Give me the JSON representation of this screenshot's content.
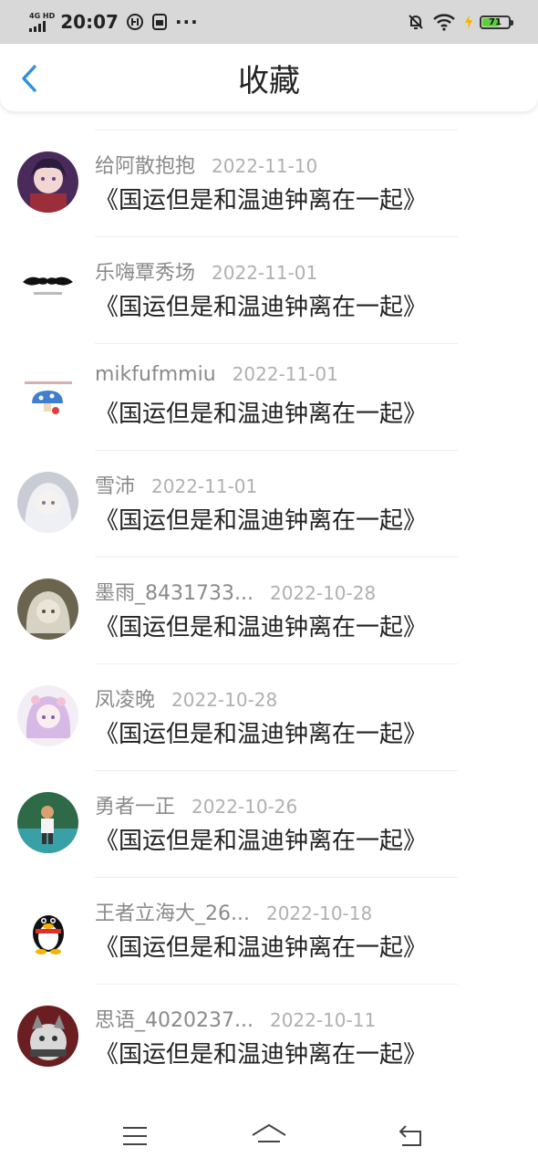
{
  "status_bar": {
    "network": "4G HD",
    "time": "20:07",
    "battery": 71,
    "battery_label": "71",
    "accent_color": "#5ad13c"
  },
  "header": {
    "title": "收藏",
    "back_icon": "chevron-left-icon",
    "accent_color": "#2f8fe0"
  },
  "favorites": [
    {
      "user": "给阿散抱抱",
      "date": "2022-11-10",
      "title": "《国运但是和温迪钟离在一起》"
    },
    {
      "user": "乐嗨覃秀场",
      "date": "2022-11-01",
      "title": "《国运但是和温迪钟离在一起》"
    },
    {
      "user": "mikfufmmiu",
      "date": "2022-11-01",
      "title": "《国运但是和温迪钟离在一起》"
    },
    {
      "user": "雪沛",
      "date": "2022-11-01",
      "title": "《国运但是和温迪钟离在一起》"
    },
    {
      "user": "墨雨_8431733...",
      "date": "2022-10-28",
      "title": "《国运但是和温迪钟离在一起》"
    },
    {
      "user": "凤凌晚",
      "date": "2022-10-28",
      "title": "《国运但是和温迪钟离在一起》"
    },
    {
      "user": "勇者一正",
      "date": "2022-10-26",
      "title": "《国运但是和温迪钟离在一起》"
    },
    {
      "user": "王者立海大_26...",
      "date": "2022-10-18",
      "title": "《国运但是和温迪钟离在一起》"
    },
    {
      "user": "思语_4020237...",
      "date": "2022-10-11",
      "title": "《国运但是和温迪钟离在一起》"
    }
  ],
  "nav": {
    "icons": [
      "menu-icon",
      "home-icon",
      "back-arrow-icon"
    ]
  }
}
